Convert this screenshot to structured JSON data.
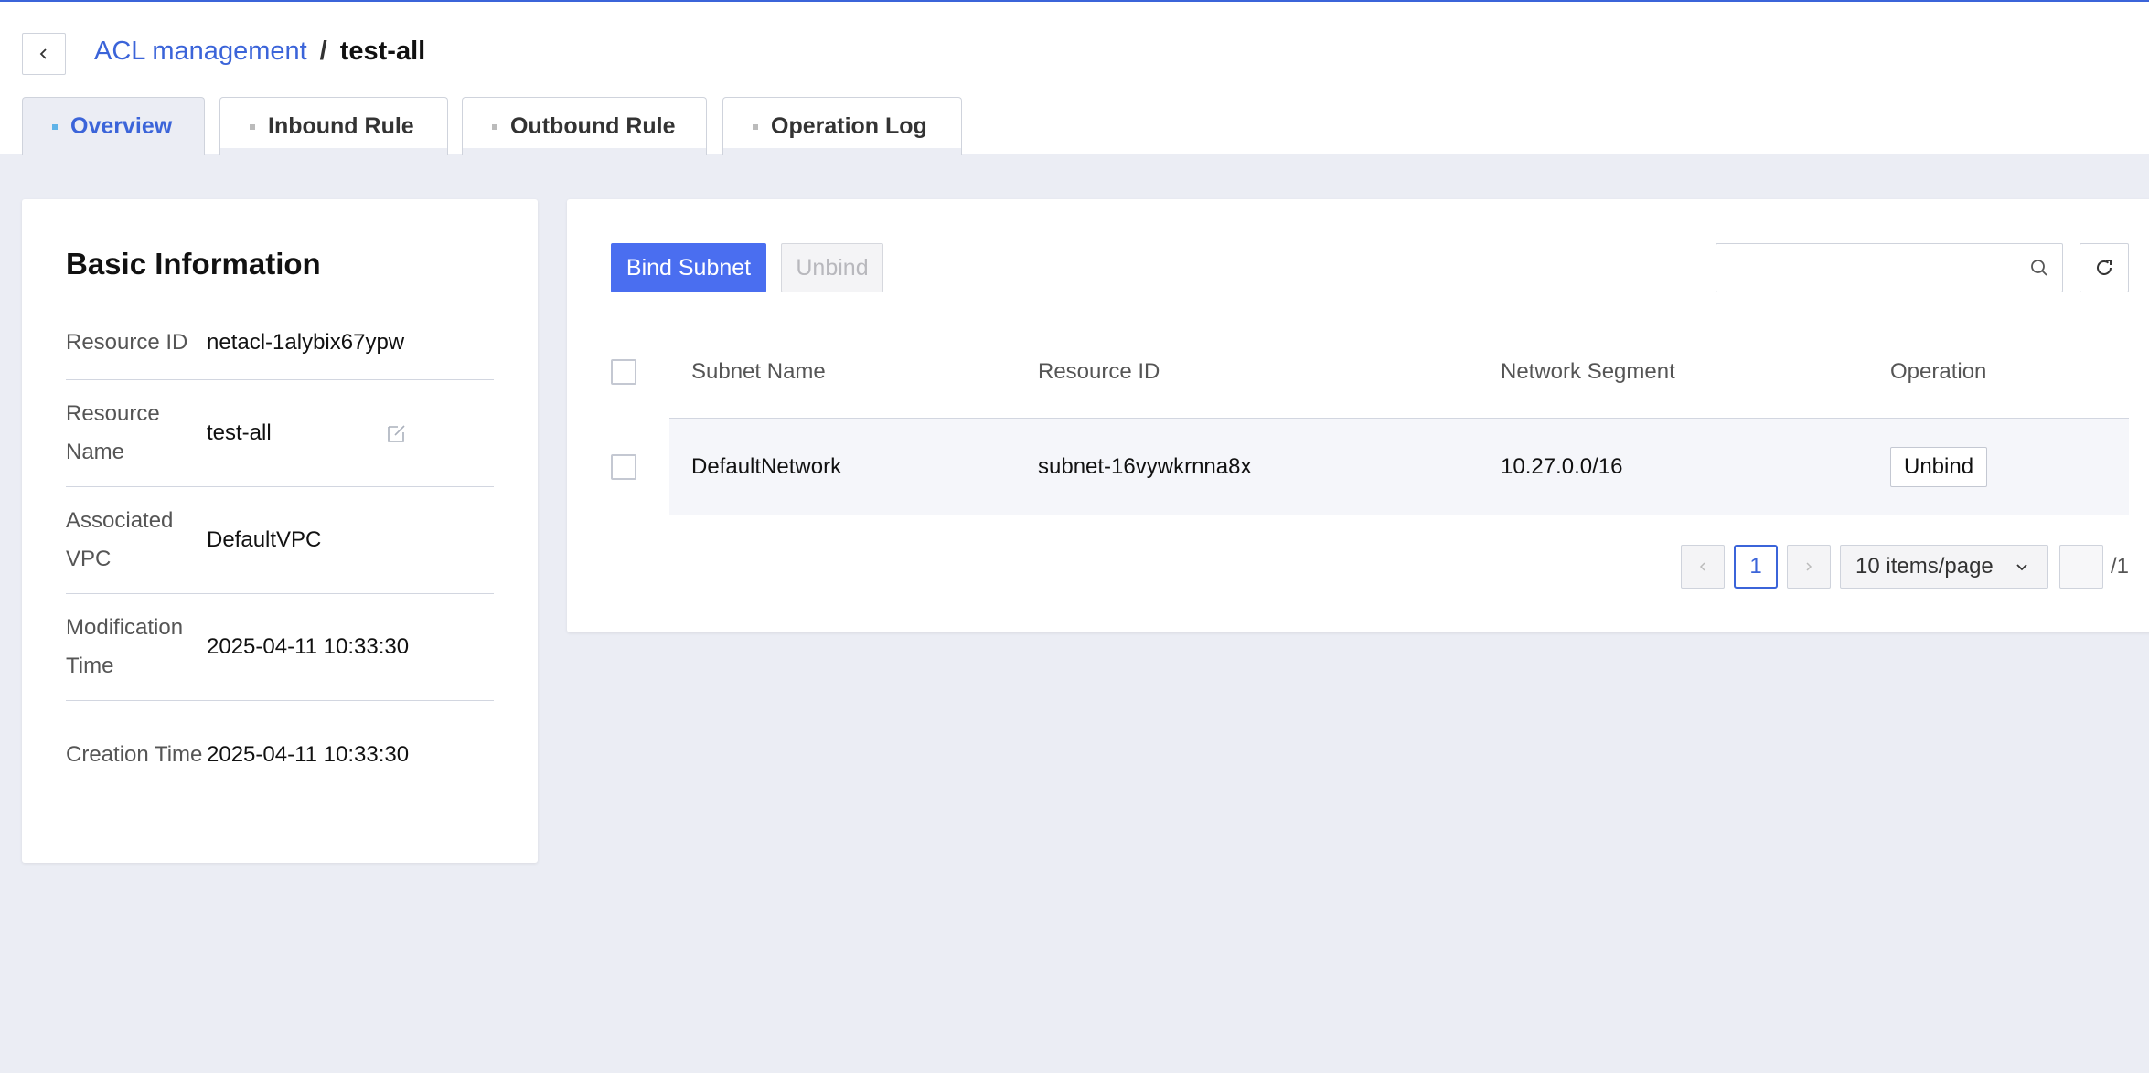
{
  "breadcrumb": {
    "parent": "ACL management",
    "separator": "/",
    "current": "test-all"
  },
  "tabs": [
    {
      "label": "Overview",
      "active": true
    },
    {
      "label": "Inbound Rule",
      "active": false
    },
    {
      "label": "Outbound Rule",
      "active": false
    },
    {
      "label": "Operation Log",
      "active": false
    }
  ],
  "basic_info": {
    "title": "Basic Information",
    "rows": [
      {
        "label": "Resource ID",
        "value": "netacl-1alybix67ypw"
      },
      {
        "label": "Resource Name",
        "value": "test-all"
      },
      {
        "label": "Associated VPC",
        "value": "DefaultVPC"
      },
      {
        "label": "Modification Time",
        "value": "2025-04-11 10:33:30"
      },
      {
        "label": "Creation Time",
        "value": "2025-04-11 10:33:30"
      }
    ]
  },
  "toolbar": {
    "bind_label": "Bind Subnet",
    "unbind_label": "Unbind",
    "search_placeholder": ""
  },
  "table": {
    "columns": [
      "Subnet Name",
      "Resource ID",
      "Network Segment",
      "Operation"
    ],
    "rows": [
      {
        "subnet_name": "DefaultNetwork",
        "resource_id": "subnet-16vywkrnna8x",
        "segment": "10.27.0.0/16",
        "operation": "Unbind"
      }
    ]
  },
  "pagination": {
    "current_page": "1",
    "page_size": "10 items/page",
    "jump_value": "",
    "total": "/1"
  },
  "colors": {
    "accent": "#3b64d9",
    "primary_button": "#4a6ef0",
    "page_bg": "#ebedf4"
  }
}
